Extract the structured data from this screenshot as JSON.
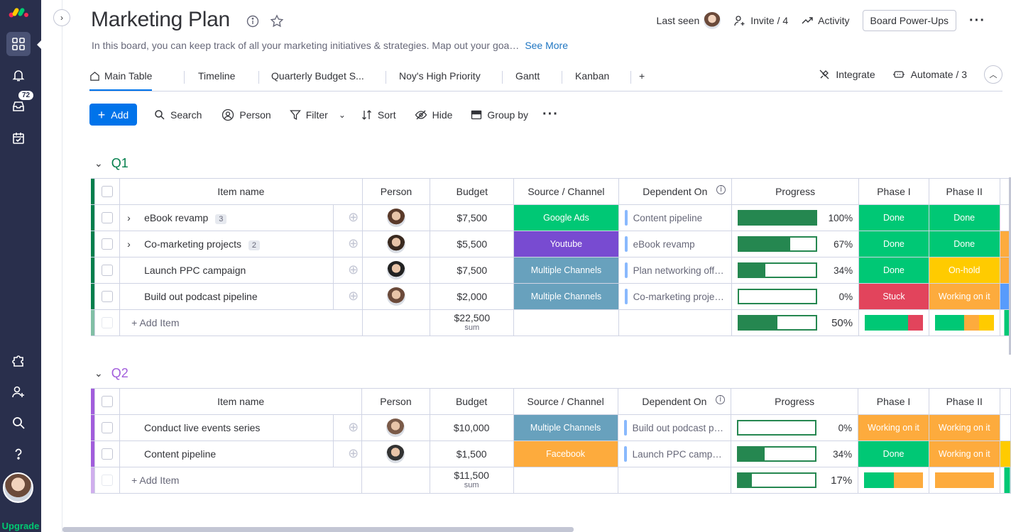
{
  "colors": {
    "rail": "#292f4c",
    "primary": "#0073ea",
    "done": "#00c875",
    "stuck": "#e2445c",
    "working": "#fdab3d",
    "onhold": "#ffcb00",
    "purple": "#784bd1",
    "steel": "#68a1bd",
    "q1": "#037f4c",
    "q2": "#a25ddc"
  },
  "rail": {
    "inbox_badge": "72",
    "upgrade_label": "Upgrade"
  },
  "board": {
    "title": "Marketing Plan",
    "description": "In this board, you can keep track of all your marketing initiatives & strategies. Map out your goa…",
    "see_more": "See More",
    "last_seen": "Last seen",
    "invite": "Invite / 4",
    "activity": "Activity",
    "power_ups": "Board Power-Ups"
  },
  "tabs": [
    "Main Table",
    "Timeline",
    "Quarterly Budget S...",
    "Noy's High Priority",
    "Gantt",
    "Kanban"
  ],
  "tabs_add": "+",
  "tabs_right": {
    "integrate": "Integrate",
    "automate": "Automate / 3"
  },
  "toolbar": {
    "add": "Add",
    "search": "Search",
    "person": "Person",
    "filter": "Filter",
    "sort": "Sort",
    "hide": "Hide",
    "group_by": "Group by"
  },
  "columns": {
    "item": "Item name",
    "person": "Person",
    "budget": "Budget",
    "source": "Source / Channel",
    "dependent": "Dependent On",
    "progress": "Progress",
    "phase1": "Phase I",
    "phase2": "Phase II"
  },
  "groups": [
    {
      "name": "Q1",
      "rows": [
        {
          "name": "eBook revamp",
          "subitems": "3",
          "budget": "$7,500",
          "source": "Google Ads",
          "source_color": "#00c875",
          "dependent": "Content pipeline",
          "progress": 100,
          "progress_label": "100%",
          "phase1": "Done",
          "phase1_color": "#00c875",
          "phase2": "Done",
          "phase2_color": "#00c875"
        },
        {
          "name": "Co-marketing projects",
          "subitems": "2",
          "budget": "$5,500",
          "source": "Youtube",
          "source_color": "#784bd1",
          "dependent": "eBook revamp",
          "progress": 67,
          "progress_label": "67%",
          "phase1": "Done",
          "phase1_color": "#00c875",
          "phase2": "Done",
          "phase2_color": "#00c875"
        },
        {
          "name": "Launch PPC campaign",
          "subitems": "",
          "budget": "$7,500",
          "source": "Multiple Channels",
          "source_color": "#68a1bd",
          "dependent": "Plan networking off…",
          "progress": 34,
          "progress_label": "34%",
          "phase1": "Done",
          "phase1_color": "#00c875",
          "phase2": "On-hold",
          "phase2_color": "#ffcb00"
        },
        {
          "name": "Build out podcast pipeline",
          "subitems": "",
          "budget": "$2,000",
          "source": "Multiple Channels",
          "source_color": "#68a1bd",
          "dependent": "Co-marketing proje…",
          "progress": 0,
          "progress_label": "0%",
          "phase1": "Stuck",
          "phase1_color": "#e2445c",
          "phase2": "Working on it",
          "phase2_color": "#fdab3d"
        }
      ],
      "add_item": "+ Add Item",
      "sum": "$22,500",
      "sum_label": "sum",
      "progress_summary": 50,
      "progress_summary_label": "50%",
      "phase1_summary": [
        {
          "color": "#00c875",
          "share": 0.75
        },
        {
          "color": "#e2445c",
          "share": 0.25
        }
      ],
      "phase2_summary": [
        {
          "color": "#00c875",
          "share": 0.5
        },
        {
          "color": "#fdab3d",
          "share": 0.25
        },
        {
          "color": "#ffcb00",
          "share": 0.25
        }
      ]
    },
    {
      "name": "Q2",
      "rows": [
        {
          "name": "Conduct live events series",
          "subitems": "",
          "budget": "$10,000",
          "source": "Multiple Channels",
          "source_color": "#68a1bd",
          "dependent": "Build out podcast p…",
          "progress": 0,
          "progress_label": "0%",
          "phase1": "Working on it",
          "phase1_color": "#fdab3d",
          "phase2": "Working on it",
          "phase2_color": "#fdab3d"
        },
        {
          "name": "Content pipeline",
          "subitems": "",
          "budget": "$1,500",
          "source": "Facebook",
          "source_color": "#fdab3d",
          "dependent": "Launch PPC camp…",
          "progress": 34,
          "progress_label": "34%",
          "phase1": "Done",
          "phase1_color": "#00c875",
          "phase2": "Working on it",
          "phase2_color": "#fdab3d"
        }
      ],
      "add_item": "+ Add Item",
      "sum": "$11,500",
      "sum_label": "sum",
      "progress_summary": 17,
      "progress_summary_label": "17%",
      "phase1_summary": [
        {
          "color": "#00c875",
          "share": 0.5
        },
        {
          "color": "#fdab3d",
          "share": 0.5
        }
      ],
      "phase2_summary": [
        {
          "color": "#fdab3d",
          "share": 1
        }
      ]
    }
  ]
}
